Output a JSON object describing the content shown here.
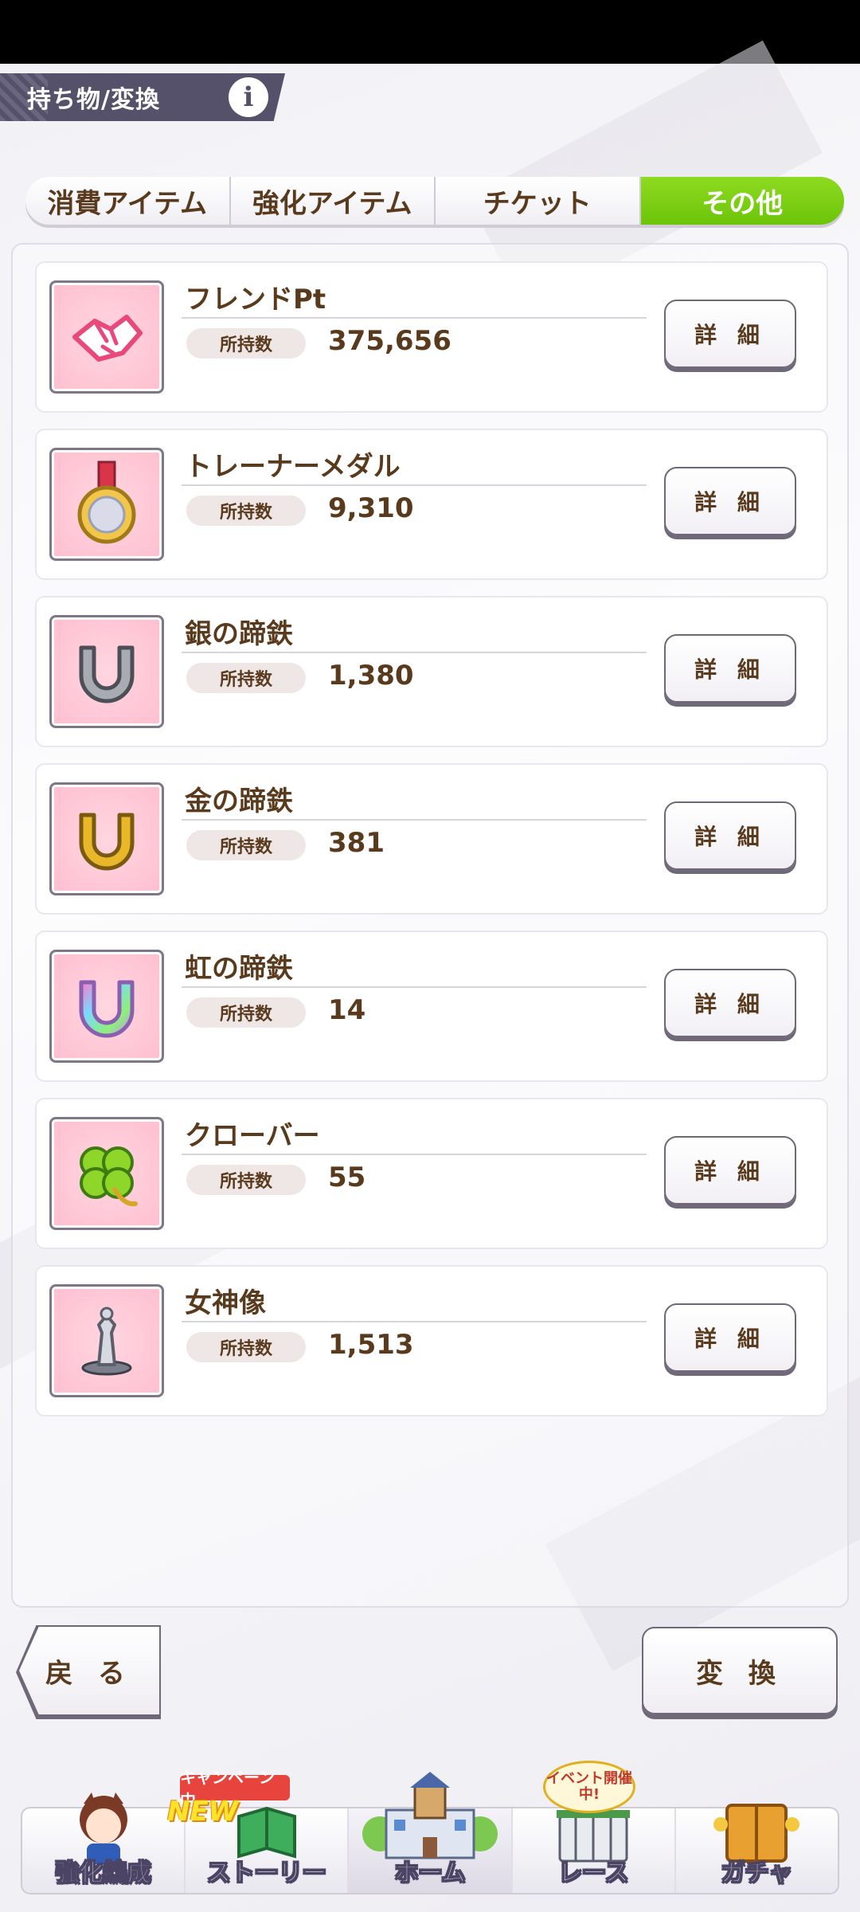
{
  "header": {
    "title": "持ち物/変換",
    "info_glyph": "i"
  },
  "tabs": [
    {
      "label": "消費アイテム",
      "active": false
    },
    {
      "label": "強化アイテム",
      "active": false
    },
    {
      "label": "チケット",
      "active": false
    },
    {
      "label": "その他",
      "active": true
    }
  ],
  "items": [
    {
      "name": "フレンドPt",
      "count_label": "所持数",
      "count": "375,656",
      "detail_label": "詳 細",
      "icon": "handshake-icon"
    },
    {
      "name": "トレーナーメダル",
      "count_label": "所持数",
      "count": "9,310",
      "detail_label": "詳 細",
      "icon": "medal-icon"
    },
    {
      "name": "銀の蹄鉄",
      "count_label": "所持数",
      "count": "1,380",
      "detail_label": "詳 細",
      "icon": "silver-horseshoe-icon"
    },
    {
      "name": "金の蹄鉄",
      "count_label": "所持数",
      "count": "381",
      "detail_label": "詳 細",
      "icon": "gold-horseshoe-icon"
    },
    {
      "name": "虹の蹄鉄",
      "count_label": "所持数",
      "count": "14",
      "detail_label": "詳 細",
      "icon": "rainbow-horseshoe-icon"
    },
    {
      "name": "クローバー",
      "count_label": "所持数",
      "count": "55",
      "detail_label": "詳 細",
      "icon": "clover-icon"
    },
    {
      "name": "女神像",
      "count_label": "所持数",
      "count": "1,513",
      "detail_label": "詳 細",
      "icon": "goddess-statue-icon"
    }
  ],
  "actions": {
    "back_label": "戻 る",
    "convert_label": "変 換"
  },
  "nav": [
    {
      "label": "強化編成",
      "icon": "character-icon"
    },
    {
      "label": "ストーリー",
      "icon": "book-icon"
    },
    {
      "label": "ホーム",
      "icon": "school-building-icon"
    },
    {
      "label": "レース",
      "icon": "race-gate-icon"
    },
    {
      "label": "ガチャ",
      "icon": "gacha-door-icon"
    }
  ],
  "badges": {
    "campaign": "キャンペーン中",
    "new": "NEW",
    "event": "イベント開催中!"
  },
  "colors": {
    "accent": "#7ccf12",
    "text": "#5a3a1c",
    "header": "#55516a",
    "icon_bg": "#ffc6d4"
  }
}
